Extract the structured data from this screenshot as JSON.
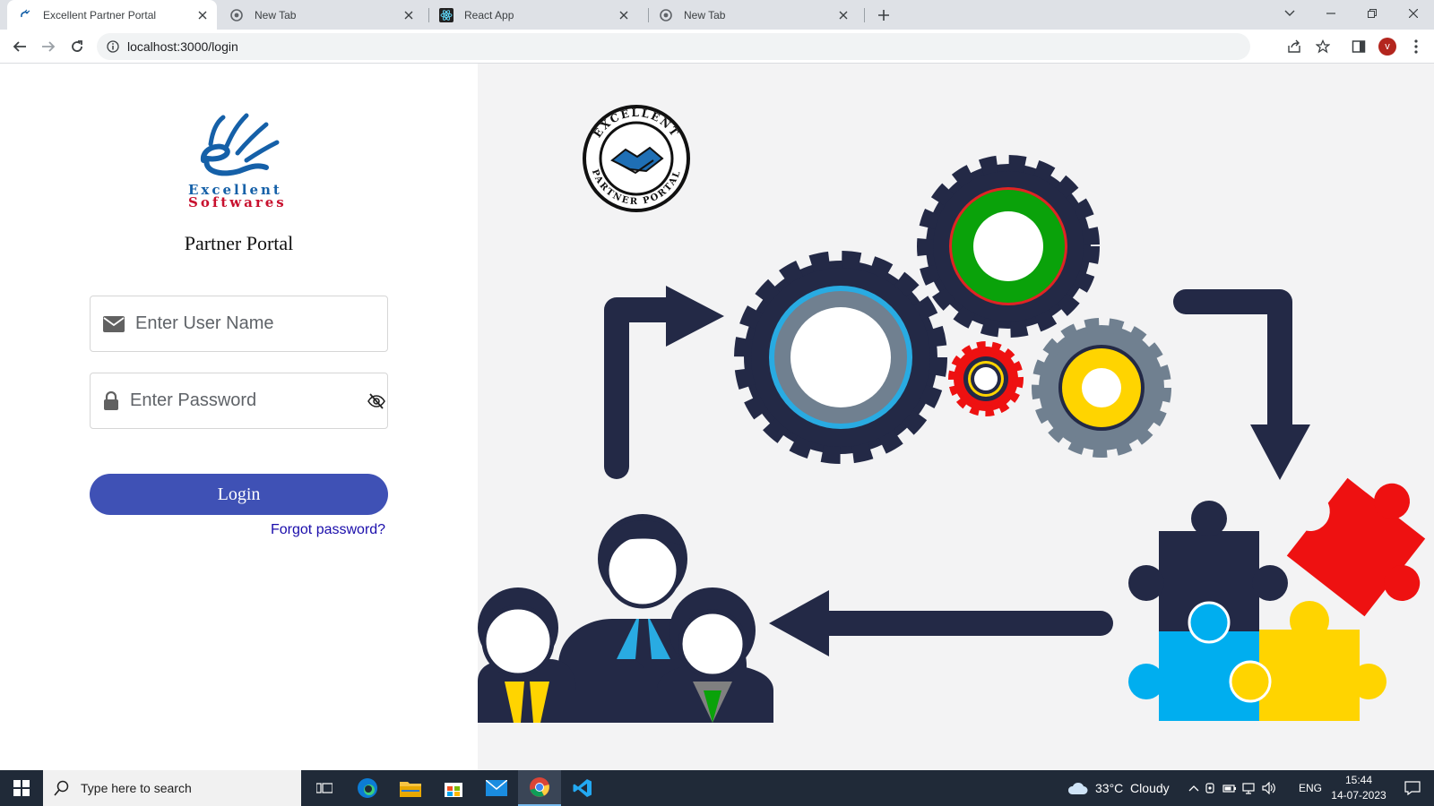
{
  "browser": {
    "tabs": [
      {
        "title": "Excellent Partner Portal",
        "active": true,
        "favicon": "excellent-favicon"
      },
      {
        "title": "New Tab",
        "active": false,
        "favicon": "chrome-icon"
      },
      {
        "title": "React App",
        "active": false,
        "favicon": "react-icon"
      },
      {
        "title": "New Tab",
        "active": false,
        "favicon": "chrome-icon"
      }
    ],
    "url": "localhost:3000/login",
    "profile_initial": "v",
    "profile_color": "#b3261e"
  },
  "login": {
    "brand_line1": "Excellent",
    "brand_line2": "Softwares",
    "title": "Partner Portal",
    "username_placeholder": "Enter User Name",
    "password_placeholder": "Enter Password",
    "login_label": "Login",
    "forgot_label": "Forgot password?",
    "accent_color": "#3f51b5"
  },
  "illustration": {
    "badge_top_text": "EXCELLENT",
    "badge_bottom_text": "PARTNER PORTAL"
  },
  "taskbar": {
    "search_placeholder": "Type here to search",
    "weather": "33°C  Cloudy",
    "language": "ENG",
    "time": "15:44",
    "date": "14-07-2023",
    "apps": [
      "task-view-icon",
      "edge-icon",
      "file-explorer-icon",
      "store-icon",
      "mail-icon",
      "chrome-icon",
      "vscode-icon"
    ]
  }
}
